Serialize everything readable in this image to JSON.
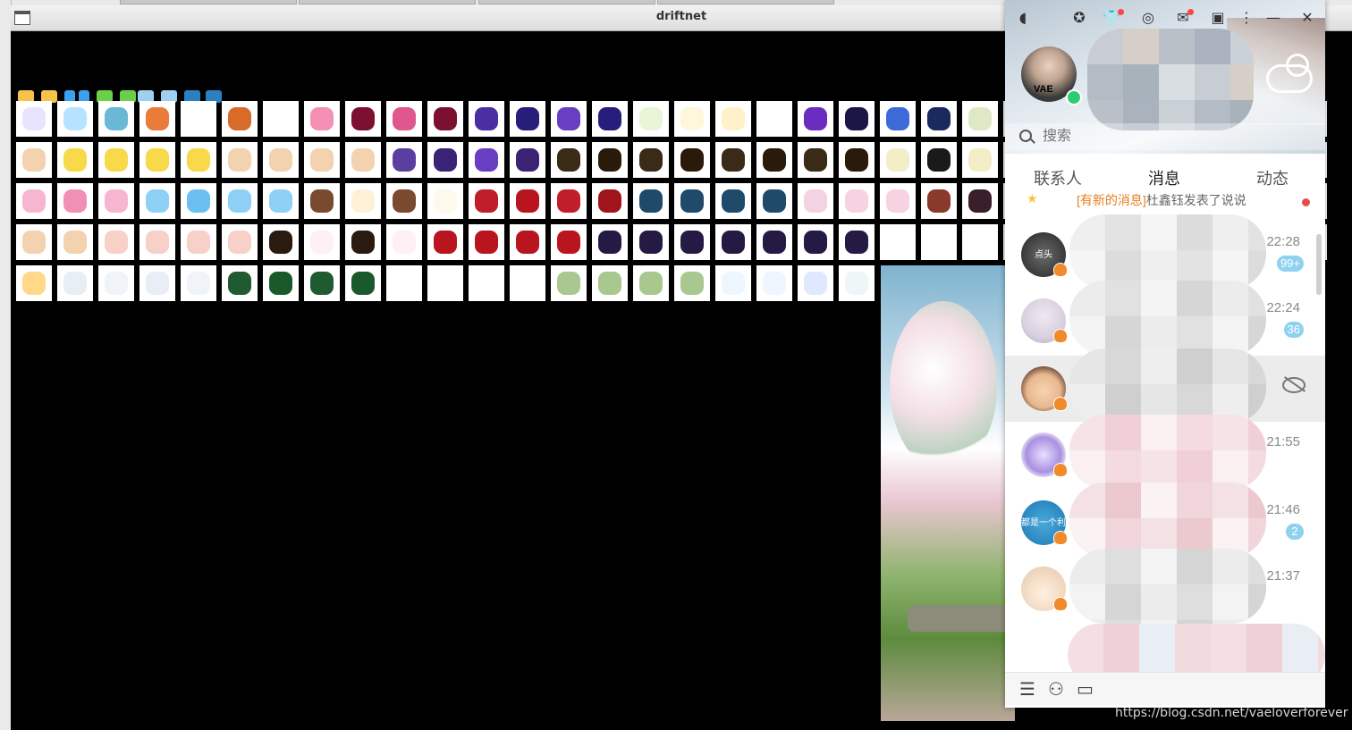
{
  "window": {
    "title": "driftnet"
  },
  "qq": {
    "search_placeholder": "搜索",
    "tabs": [
      {
        "label": "联系人"
      },
      {
        "label": "消息"
      },
      {
        "label": "动态"
      }
    ],
    "active_tab": "消息",
    "system_message": {
      "new_tag": "[有新的消息]",
      "text": "杜鑫钰发表了说说"
    },
    "conversations": [
      {
        "time": "22:28",
        "badge": "99+",
        "avatar_text": "点头"
      },
      {
        "time": "22:24",
        "badge": "36"
      },
      {
        "time": "",
        "badge": "",
        "muted": true
      },
      {
        "time": "21:55",
        "badge": ""
      },
      {
        "time": "21:46",
        "badge": "2",
        "avatar_text": "都是一个利用"
      },
      {
        "time": "21:37",
        "badge": ""
      }
    ],
    "self_avatar_text": "VAE"
  },
  "watermark": "https://blog.csdn.net/vaeloverforever",
  "colors": {
    "accent": "#8fd1ef",
    "online": "#2ecc71",
    "new_tag": "#e87d1f"
  }
}
